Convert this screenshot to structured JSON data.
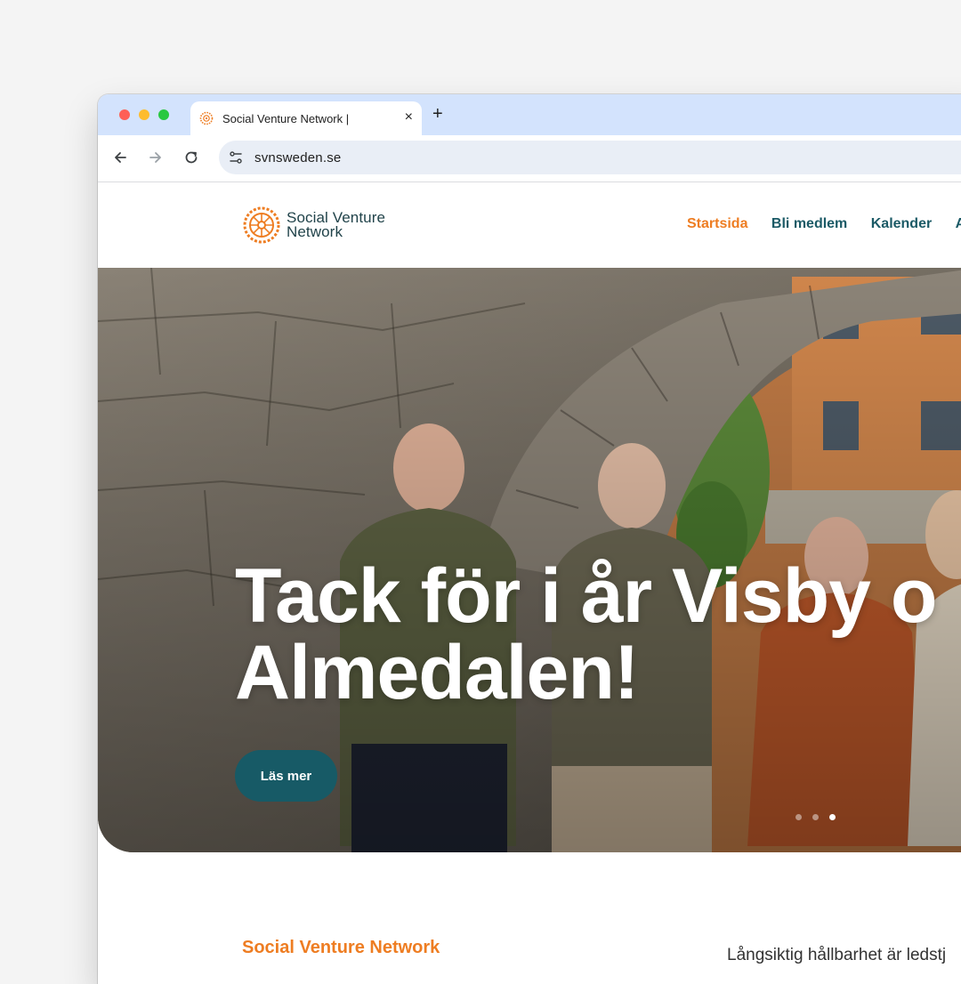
{
  "browser": {
    "tab_title": "Social Venture Network |",
    "tab_close_glyph": "×",
    "new_tab_glyph": "+",
    "url": "svnsweden.se",
    "icons": [
      "back-arrow-icon",
      "forward-arrow-icon",
      "reload-icon",
      "site-settings-icon",
      "favicon-icon"
    ]
  },
  "site": {
    "logo": {
      "line1": "Social Venture",
      "line2": "Network"
    },
    "nav": [
      {
        "label": "Startsida",
        "active": true
      },
      {
        "label": "Bli medlem",
        "active": false
      },
      {
        "label": "Kalender",
        "active": false
      },
      {
        "label": "A",
        "active": false
      }
    ]
  },
  "hero": {
    "title_line1": "Tack för i år Visby o",
    "title_line2": "Almedalen!",
    "button_label": "Läs mer",
    "slide_count": 3,
    "active_slide": 3
  },
  "intro": {
    "heading": "Social Venture Network",
    "lead": "Långsiktig hållbarhet är ledstj"
  },
  "colors": {
    "accent_orange": "#ee7d22",
    "brand_teal": "#1b5a66",
    "tabbar_blue": "#d3e3fd"
  }
}
